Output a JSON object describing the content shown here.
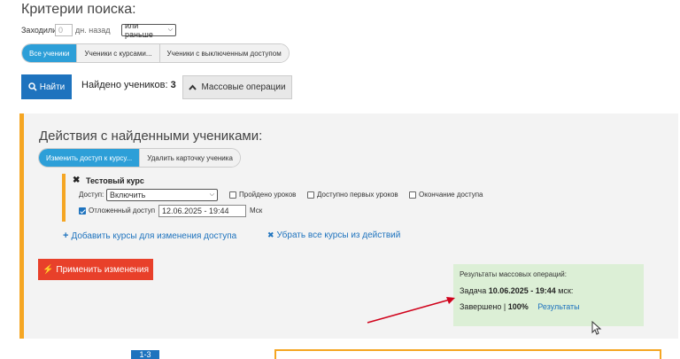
{
  "criteria": {
    "title": "Критерии поиска:",
    "visited_label": "Заходили",
    "days_placeholder": "0",
    "days_suffix": "дн. назад",
    "period_select": "или раньше"
  },
  "filter_tabs": [
    {
      "label": "Все ученики",
      "active": true
    },
    {
      "label": "Ученики с курсами...",
      "active": false
    },
    {
      "label": "Ученики с выключенным доступом",
      "active": false
    }
  ],
  "search": {
    "find_label": "Найти",
    "found_prefix": "Найдено учеников:",
    "found_count": "3",
    "mass_ops_label": "Массовые операции"
  },
  "actions": {
    "title": "Действия с найденными учениками:",
    "tabs": [
      {
        "label": "Изменить доступ к курсу...",
        "active": true
      },
      {
        "label": "Удалить карточку ученика",
        "active": false
      }
    ],
    "course": {
      "name": "Тестовый курс",
      "access_label": "Доступ:",
      "access_value": "Включить",
      "options": [
        {
          "label": "Пройдено уроков",
          "checked": false
        },
        {
          "label": "Доступно первых уроков",
          "checked": false
        },
        {
          "label": "Окончание доступа",
          "checked": false
        }
      ],
      "deferred_label": "Отложенный доступ",
      "deferred_checked": true,
      "deferred_value": "12.06.2025 - 19:44",
      "timezone": "Мск"
    },
    "add_courses_label": "Добавить курсы для изменения доступа",
    "remove_courses_label": "Убрать все курсы из действий",
    "apply_label": "Применить изменения"
  },
  "results": {
    "title": "Результаты массовых операций:",
    "task_prefix": "Задача",
    "task_time": "10.06.2025 - 19:44",
    "task_suffix": "мск:",
    "status_prefix": "Завершено |",
    "status_percent": "100%",
    "results_link": "Результаты"
  },
  "pager": {
    "label": "1-3"
  },
  "colors": {
    "primary": "#1e73be",
    "pill_active": "#2d9fd8",
    "apply_red": "#e8402a",
    "accent_orange": "#f5a623",
    "result_green": "#dcefd6",
    "arrow_red": "#d0021b"
  }
}
